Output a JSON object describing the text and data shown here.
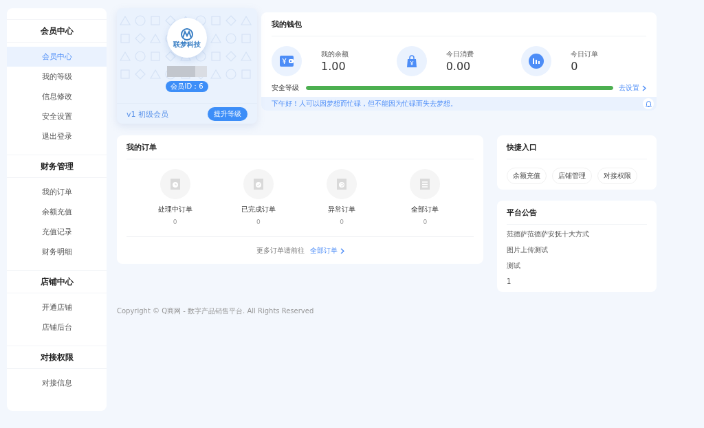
{
  "sidebar": {
    "sections": [
      {
        "title": "会员中心",
        "items": [
          {
            "label": "会员中心",
            "selected": true
          },
          {
            "label": "我的等级",
            "selected": false
          },
          {
            "label": "信息修改",
            "selected": false
          },
          {
            "label": "安全设置",
            "selected": false
          },
          {
            "label": "退出登录",
            "selected": false
          }
        ]
      },
      {
        "title": "财务管理",
        "items": [
          {
            "label": "我的订单",
            "selected": false
          },
          {
            "label": "余额充值",
            "selected": false
          },
          {
            "label": "充值记录",
            "selected": false
          },
          {
            "label": "财务明细",
            "selected": false
          }
        ]
      },
      {
        "title": "店铺中心",
        "items": [
          {
            "label": "开通店铺",
            "selected": false
          },
          {
            "label": "店铺后台",
            "selected": false
          }
        ]
      },
      {
        "title": "对接权限",
        "items": [
          {
            "label": "对接信息",
            "selected": false
          }
        ]
      }
    ]
  },
  "profile": {
    "logo_text": "联梦科技",
    "member_id": "会员ID：6",
    "level": "v1 初级会员",
    "upgrade_button": "提升等级"
  },
  "wallet": {
    "title": "我的钱包",
    "stats": [
      {
        "label": "我的余额",
        "value": "1.00",
        "kind": "wallet"
      },
      {
        "label": "今日消费",
        "value": "0.00",
        "kind": "bag"
      },
      {
        "label": "今日订单",
        "value": "0",
        "kind": "chart"
      }
    ],
    "security": {
      "label": "安全等级",
      "level": 1,
      "link": "去设置"
    },
    "greeting": "下午好！人可以因梦想而忙碌，但不能因为忙碌而失去梦想。"
  },
  "orders": {
    "title": "我的订单",
    "items": [
      {
        "label": "处理中订单",
        "count": "0",
        "kind": "pending"
      },
      {
        "label": "已完成订单",
        "count": "0",
        "kind": "done"
      },
      {
        "label": "异常订单",
        "count": "0",
        "kind": "error"
      },
      {
        "label": "全部订单",
        "count": "0",
        "kind": "all"
      }
    ],
    "more_text": "更多订单请前往",
    "more_link": "全部订单"
  },
  "quick_entry": {
    "title": "快捷入口",
    "buttons": [
      "余额充值",
      "店铺管理",
      "对接权限"
    ]
  },
  "notices": {
    "title": "平台公告",
    "items": [
      "范德萨范德萨安抚十大方式",
      "图片上传测试",
      "测试",
      "1"
    ]
  },
  "footer": "Copyright © Q商网 - 数字产品销售平台. All Rights Reserved"
}
